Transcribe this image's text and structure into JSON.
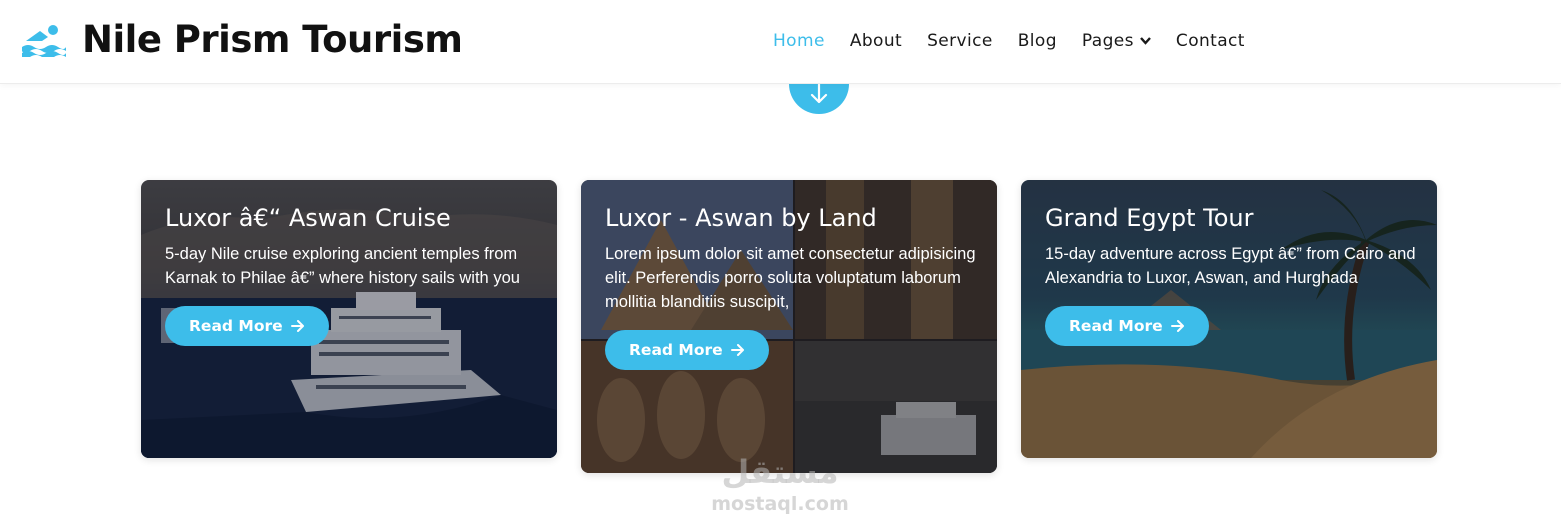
{
  "brand": {
    "name": "Nile Prism Tourism",
    "icon": "swimmer-icon"
  },
  "nav": {
    "items": [
      {
        "label": "Home",
        "active": true
      },
      {
        "label": "About",
        "active": false
      },
      {
        "label": "Service",
        "active": false
      },
      {
        "label": "Blog",
        "active": false
      },
      {
        "label": "Pages",
        "active": false,
        "has_dropdown": true
      },
      {
        "label": "Contact",
        "active": false
      }
    ]
  },
  "scroll_button": {
    "icon": "arrow-down-icon"
  },
  "cards": [
    {
      "title": "Luxor â€“ Aswan Cruise",
      "description": "5-day Nile cruise exploring ancient temples from Karnak to Philae â€” where history sails with you",
      "button": "Read More",
      "image": "nile-cruise-ship-image"
    },
    {
      "title": "Luxor - Aswan by Land",
      "description": "Lorem ipsum dolor sit amet consectetur adipisicing elit. Perferendis porro soluta voluptatum laborum mollitia blanditiis suscipit,",
      "button": "Read More",
      "image": "egypt-monuments-collage-image"
    },
    {
      "title": "Grand Egypt Tour",
      "description": "15-day adventure across Egypt â€” from Cairo and Alexandria to Luxor, Aswan, and Hurghada",
      "button": "Read More",
      "image": "palm-beach-image"
    }
  ],
  "watermark": {
    "arabic": "مستقل",
    "latin": "mostaql.com"
  },
  "colors": {
    "accent": "#3dbdea",
    "text_dark": "#111111",
    "background": "#ffffff"
  }
}
